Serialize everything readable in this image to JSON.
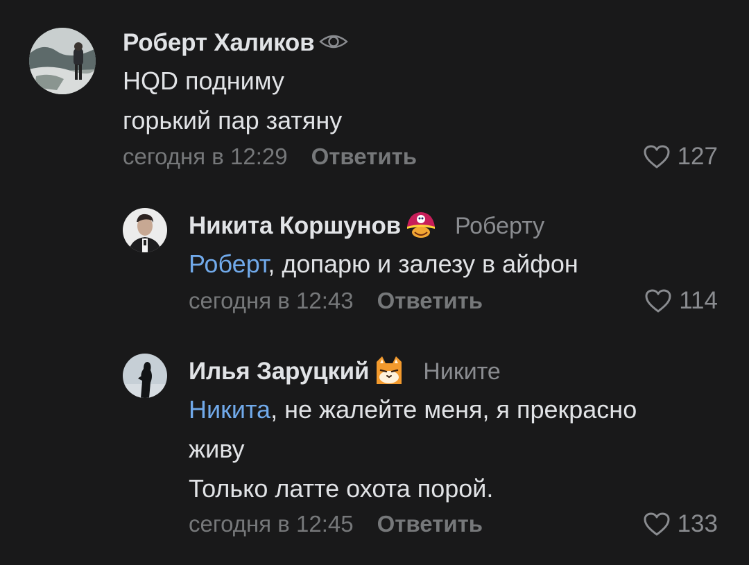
{
  "comments": [
    {
      "author": "Роберт Халиков",
      "badge_icon": "eye-icon",
      "reply_to": "",
      "mention": "",
      "lines": [
        "HQD подниму",
        "горький пар затяну"
      ],
      "date": "сегодня в 12:29",
      "reply_label": "Ответить",
      "likes": "127"
    },
    {
      "author": "Никита Коршунов",
      "badge_icon": "pirate-emoji-icon",
      "reply_to": "Роберту",
      "mention": "Роберт",
      "lines": [
        ", допарю и залезу в айфон"
      ],
      "date": "сегодня в 12:43",
      "reply_label": "Ответить",
      "likes": "114"
    },
    {
      "author": "Илья Заруцкий",
      "badge_icon": "cat-emoji-icon",
      "reply_to": "Никите",
      "mention": "Никита",
      "lines": [
        ", не жалейте меня, я прекрасно",
        "живу",
        "Только латте охота порой."
      ],
      "date": "сегодня в 12:45",
      "reply_label": "Ответить",
      "likes": "133"
    }
  ],
  "colors": {
    "background": "#19191a",
    "text": "#e1e3e6",
    "secondary": "#76787a",
    "mention": "#71aaeb"
  }
}
